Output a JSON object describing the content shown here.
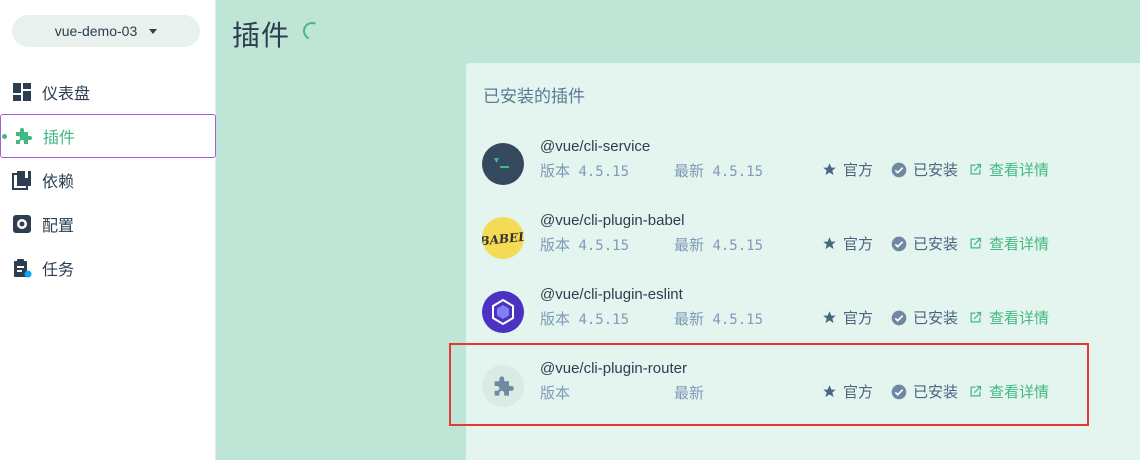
{
  "project": {
    "name": "vue-demo-03"
  },
  "nav": [
    {
      "label": "仪表盘",
      "icon": "dashboard-icon"
    },
    {
      "label": "插件",
      "icon": "puzzle-icon",
      "active": true
    },
    {
      "label": "依赖",
      "icon": "book-icon"
    },
    {
      "label": "配置",
      "icon": "gear-icon"
    },
    {
      "label": "任务",
      "icon": "clipboard-icon"
    }
  ],
  "header": {
    "title": "插件"
  },
  "panel": {
    "title": "已安装的插件",
    "plugins": [
      {
        "name": "@vue/cli-service",
        "version_label": "版本",
        "version": "4.5.15",
        "latest_label": "最新",
        "latest": "4.5.15",
        "official": "官方",
        "installed": "已安装",
        "details": "查看详情",
        "logo": "vue-cli-logo"
      },
      {
        "name": "@vue/cli-plugin-babel",
        "version_label": "版本",
        "version": "4.5.15",
        "latest_label": "最新",
        "latest": "4.5.15",
        "official": "官方",
        "installed": "已安装",
        "details": "查看详情",
        "logo": "babel-logo"
      },
      {
        "name": "@vue/cli-plugin-eslint",
        "version_label": "版本",
        "version": "4.5.15",
        "latest_label": "最新",
        "latest": "4.5.15",
        "official": "官方",
        "installed": "已安装",
        "details": "查看详情",
        "logo": "eslint-logo"
      },
      {
        "name": "@vue/cli-plugin-router",
        "version_label": "版本",
        "version": "",
        "latest_label": "最新",
        "latest": "",
        "official": "官方",
        "installed": "已安装",
        "details": "查看详情",
        "logo": "puzzle-icon"
      }
    ]
  },
  "colors": {
    "accent": "#42b983",
    "background": "#bfe5d6",
    "panel": "#e4f4ee",
    "highlight": "#e53935"
  }
}
